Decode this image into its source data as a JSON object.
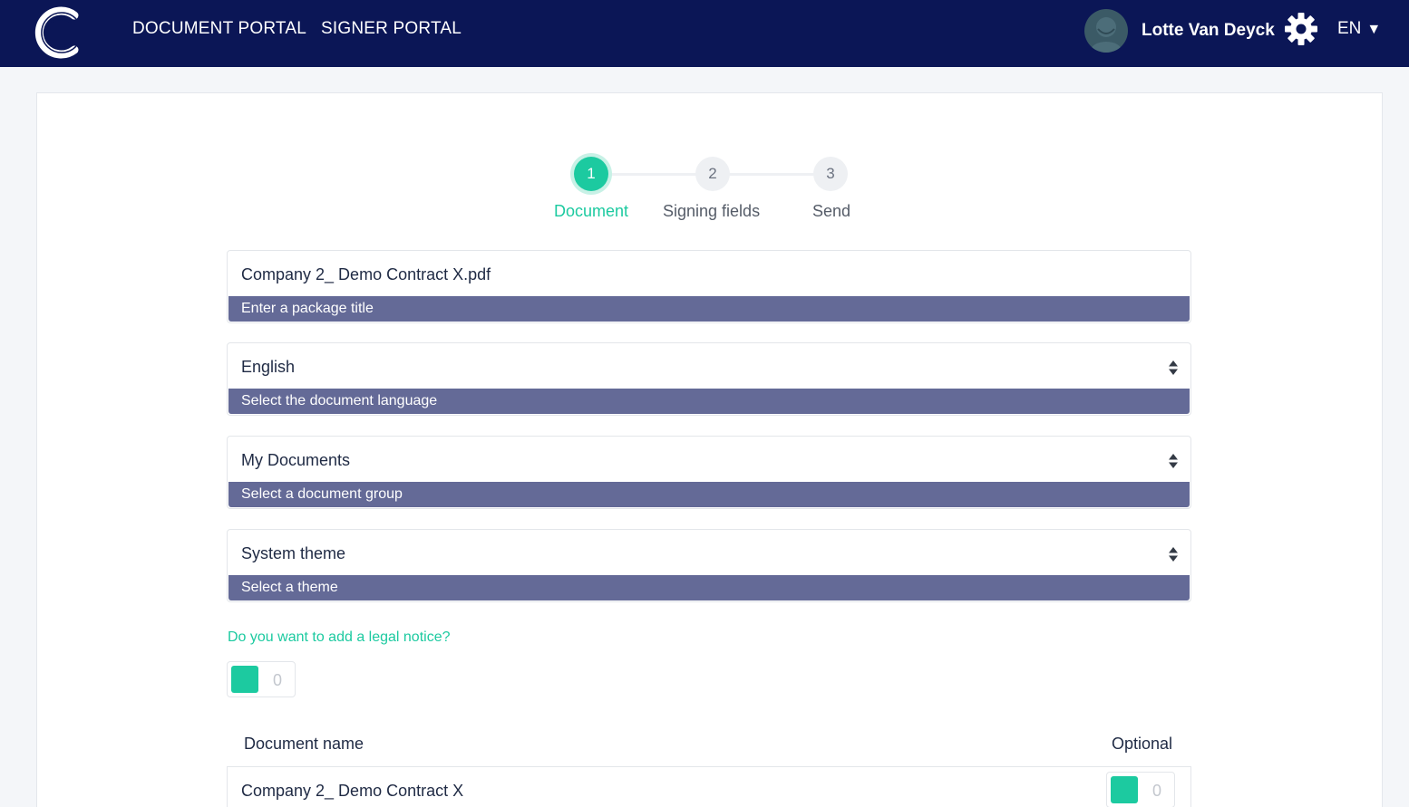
{
  "header": {
    "nav": [
      "DOCUMENT PORTAL",
      "SIGNER PORTAL"
    ],
    "user_name": "Lotte Van Deyck",
    "language": "EN"
  },
  "stepper": {
    "steps": [
      {
        "number": "1",
        "label": "Document",
        "active": true
      },
      {
        "number": "2",
        "label": "Signing fields",
        "active": false
      },
      {
        "number": "3",
        "label": "Send",
        "active": false
      }
    ]
  },
  "form": {
    "package_title": {
      "value": "Company 2_ Demo Contract X.pdf",
      "hint": "Enter a package title"
    },
    "language": {
      "value": "English",
      "hint": "Select the document language"
    },
    "document_group": {
      "value": "My Documents",
      "hint": "Select a document group"
    },
    "theme": {
      "value": "System theme",
      "hint": "Select a theme"
    },
    "legal_notice_question": "Do you want to add a legal notice?",
    "legal_notice_toggle": "0"
  },
  "documents": {
    "columns": [
      "Document name",
      "Optional"
    ],
    "rows": [
      {
        "name": "Company 2_ Demo Contract X",
        "optional": "0"
      }
    ]
  },
  "colors": {
    "navbar": "#0b1656",
    "accent": "#1ccaa0",
    "hint_bar": "#646a97"
  }
}
